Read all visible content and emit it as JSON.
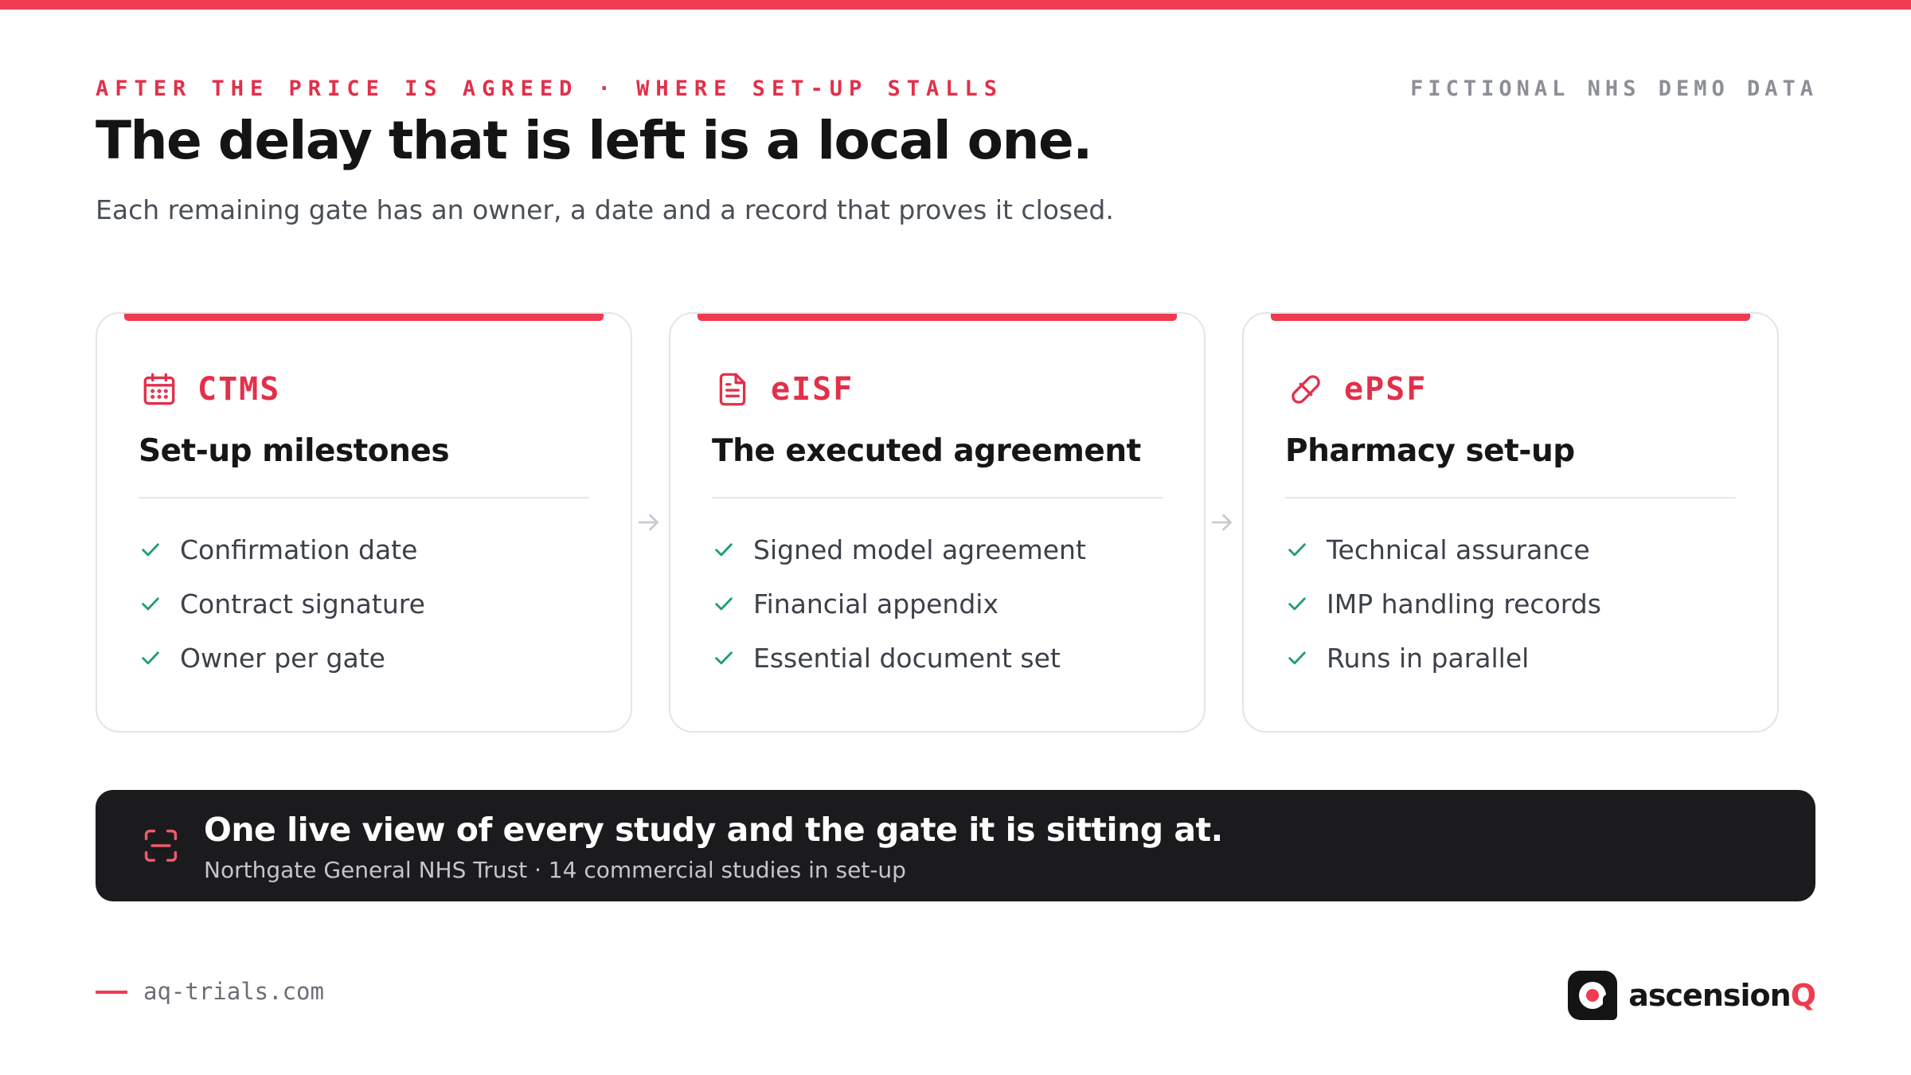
{
  "header": {
    "eyebrow": "AFTER THE PRICE IS AGREED · WHERE SET-UP STALLS",
    "demo_tag": "FICTIONAL NHS DEMO DATA",
    "headline": "The delay that is left is a local one.",
    "subhead": "Each remaining gate has an owner, a date and a record that proves it closed."
  },
  "cards": [
    {
      "system": "CTMS",
      "icon": "calendar-icon",
      "title": "Set-up milestones",
      "items": [
        "Confirmation date",
        "Contract signature",
        "Owner per gate"
      ]
    },
    {
      "system": "eISF",
      "icon": "document-icon",
      "title": "The executed agreement",
      "items": [
        "Signed model agreement",
        "Financial appendix",
        "Essential document set"
      ]
    },
    {
      "system": "ePSF",
      "icon": "pill-icon",
      "title": "Pharmacy set-up",
      "items": [
        "Technical assurance",
        "IMP handling records",
        "Runs in parallel"
      ]
    }
  ],
  "banner": {
    "icon": "scan-icon",
    "title": "One live view of every study and the gate it is sitting at.",
    "subtitle": "Northgate General NHS Trust · 14 commercial studies in set-up"
  },
  "footer": {
    "url": "aq-trials.com",
    "brand_prefix": "ascension",
    "brand_suffix": "Q"
  },
  "colors": {
    "accent": "#ef3a52",
    "check": "#1f9d6b",
    "banner_bg": "#1b1b1d",
    "text": "#161616"
  }
}
